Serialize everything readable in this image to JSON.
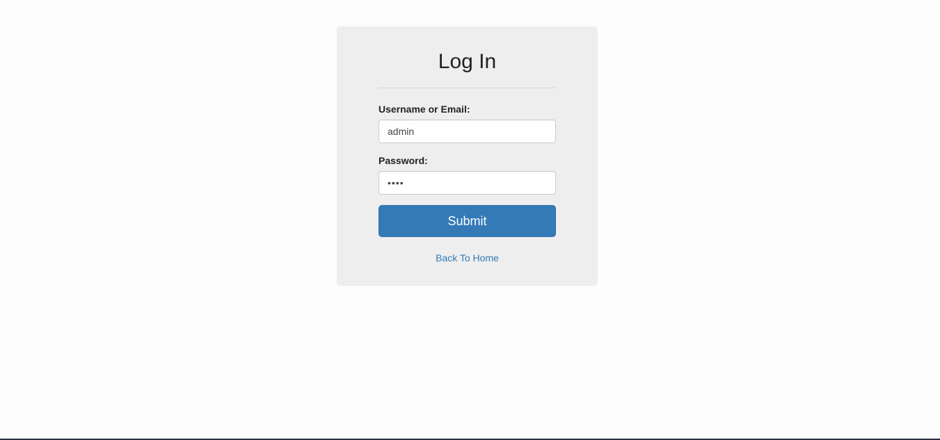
{
  "login": {
    "title": "Log In",
    "username_label": "Username or Email:",
    "username_value": "admin",
    "password_label": "Password:",
    "password_value": "pass",
    "submit_label": "Submit",
    "back_link": "Back To Home"
  },
  "colors": {
    "primary": "#337ab7",
    "card_background": "#eeeeee",
    "page_background": "#fdfdfd"
  }
}
